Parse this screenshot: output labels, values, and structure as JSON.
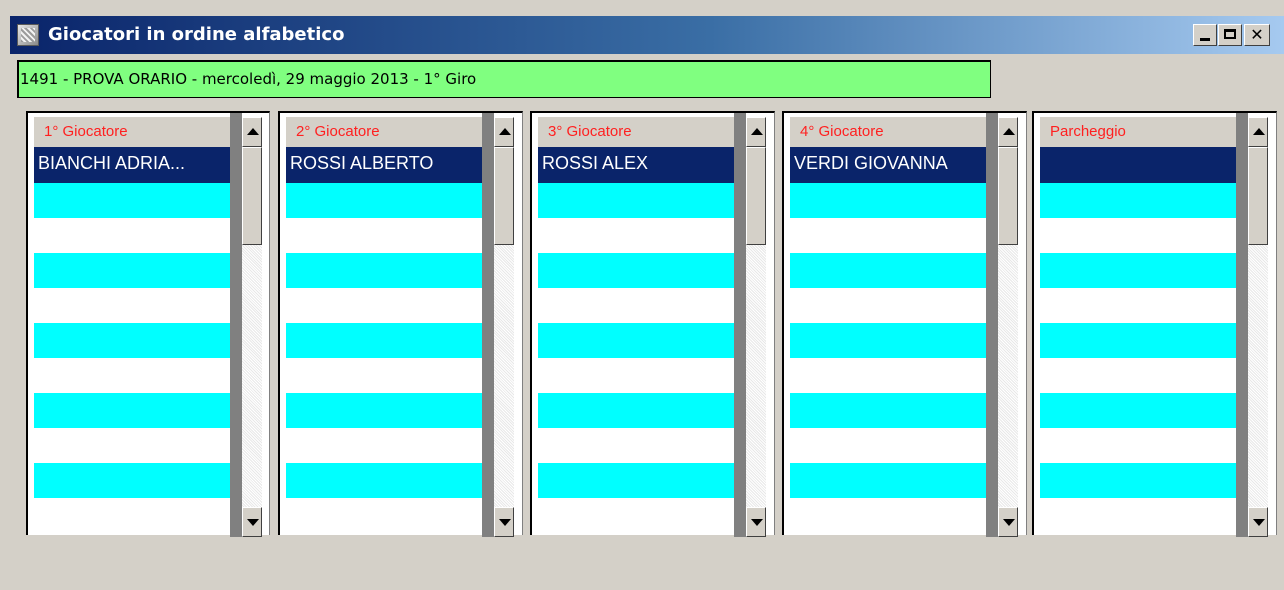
{
  "window": {
    "title": "Giocatori in ordine alfabetico",
    "icon": "app-icon"
  },
  "info_line": "1491 - PROVA ORARIO - mercoledì, 29 maggio 2013 - 1° Giro",
  "colors": {
    "info_bg": "#80ff80",
    "header_text": "#ff2020",
    "selected_bg": "#0a246a",
    "alt_row": "#00ffff"
  },
  "columns": [
    {
      "header": "1° Giocatore",
      "selected": "BIANCHI ADRIA..."
    },
    {
      "header": "2° Giocatore",
      "selected": "ROSSI ALBERTO"
    },
    {
      "header": "3° Giocatore",
      "selected": "ROSSI ALEX"
    },
    {
      "header": "4° Giocatore",
      "selected": "VERDI GIOVANNA"
    },
    {
      "header": "Parcheggio",
      "selected": ""
    }
  ]
}
